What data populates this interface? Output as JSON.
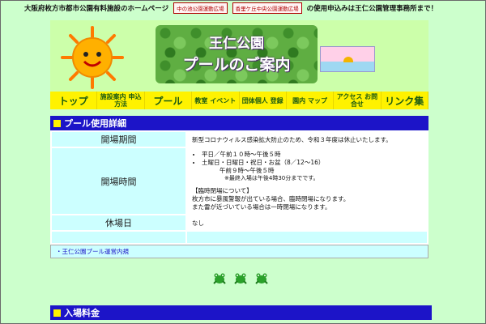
{
  "top": {
    "site_title": "大阪府枚方市都市公園有料施設のホームページ",
    "link1": "中の池公園運動広場",
    "link2": "香里ケ丘中央公園運動広場",
    "note": "の使用申込みは王仁公園管理事務所まで！"
  },
  "header": {
    "title_line1": "王仁公園",
    "title_line2": "プールのご案内"
  },
  "nav": [
    {
      "label": "トップ"
    },
    {
      "label": "施設案内 申込方法"
    },
    {
      "label": "プール"
    },
    {
      "label": "教室 イベント"
    },
    {
      "label": "団体個人 登録"
    },
    {
      "label": "園内 マップ"
    },
    {
      "label": "アクセス お問合せ"
    },
    {
      "label": "リンク集"
    }
  ],
  "section": {
    "title": "プール使用詳細"
  },
  "rows": {
    "period_label": "開場期間",
    "period_value": "新型コロナウィルス感染拡大防止のため、令和３年度は休止いたします。",
    "hours_label": "開場時間",
    "hours_1": "平日／午前１０時〜午後５時",
    "hours_2": "土曜日・日曜日・祝日・お盆（8／12〜16）",
    "hours_3": "午前９時〜午後５時",
    "hours_note": "※最終入場は午後4時30分までです。",
    "temp_title": "【臨時閉場について】",
    "temp_1": "枚方市に暴風警報が出ている場合、臨時閉場になります。",
    "temp_2": "また雷が近づいている場合は一時閉場になります。",
    "closed_label": "休場日",
    "closed_value": "なし"
  },
  "regs_link": "・王仁公園プール運営内規",
  "lower_section": {
    "title": "入場料金"
  },
  "icons": {
    "sun": "sun-face-icon",
    "frog": "frog-icon"
  }
}
